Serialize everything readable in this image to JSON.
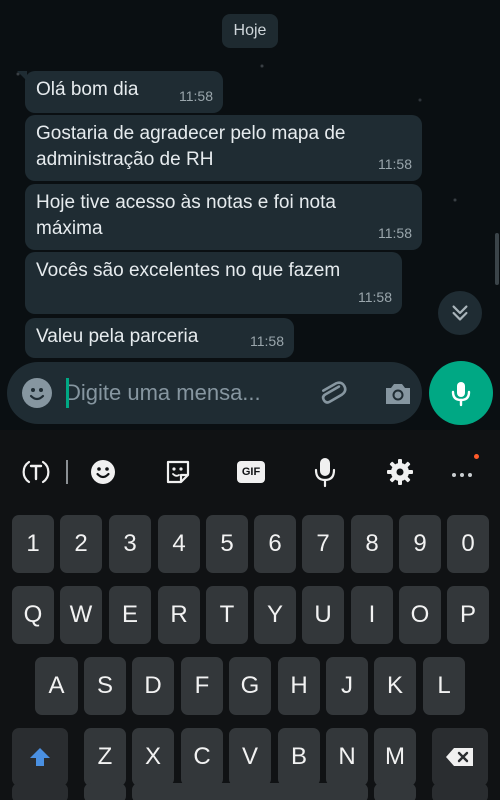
{
  "chat": {
    "date_label": "Hoje",
    "messages": [
      {
        "lines": [
          "Olá bom dia"
        ],
        "time": "11:58"
      },
      {
        "lines": [
          "Gostaria de agradecer pelo mapa de",
          "administração de RH"
        ],
        "time": "11:58"
      },
      {
        "lines": [
          "Hoje tive acesso às notas e foi nota",
          "máxima"
        ],
        "time": "11:58"
      },
      {
        "lines": [
          "Vocês são excelentes no que fazem"
        ],
        "time": "11:58"
      },
      {
        "lines": [
          "Valeu pela parceria"
        ],
        "time": "11:58"
      }
    ]
  },
  "composer": {
    "placeholder": "Digite uma mensa..."
  },
  "keyboard": {
    "toolbar": {
      "gif_label": "GIF",
      "icons": [
        "translate-icon",
        "emoji-icon",
        "sticker-icon",
        "gif-icon",
        "voice-input-icon",
        "settings-icon",
        "more-icon"
      ]
    },
    "row_numbers": [
      "1",
      "2",
      "3",
      "4",
      "5",
      "6",
      "7",
      "8",
      "9",
      "0"
    ],
    "row_top": [
      "Q",
      "W",
      "E",
      "R",
      "T",
      "Y",
      "U",
      "I",
      "O",
      "P"
    ],
    "row_middle": [
      "A",
      "S",
      "D",
      "F",
      "G",
      "H",
      "J",
      "K",
      "L"
    ],
    "row_bottom": [
      "Z",
      "X",
      "C",
      "V",
      "B",
      "N",
      "M"
    ]
  },
  "colors": {
    "accent": "#00a884",
    "bubble": "#1f2c33",
    "key": "#33373a",
    "shift_arrow": "#4a90e2"
  }
}
